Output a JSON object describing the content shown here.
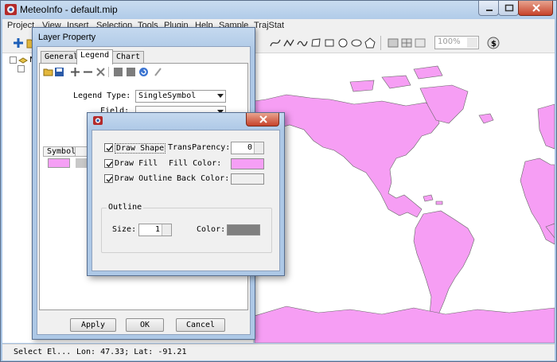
{
  "app": {
    "title": "MeteoInfo - default.mip"
  },
  "menu": [
    "Project",
    "View",
    "Insert",
    "Selection",
    "Tools",
    "Plugin",
    "Help",
    "Sample",
    "TrajStat"
  ],
  "toolbar": {
    "zoom_value": "100%"
  },
  "legend_tree": {
    "root_label": "Ne"
  },
  "status": {
    "left": "Select El...",
    "coords": "Lon: 47.33; Lat: -91.21"
  },
  "layer_dialog": {
    "title": "Layer Property",
    "tabs": [
      "General",
      "Legend",
      "Chart"
    ],
    "legend_type_label": "Legend Type:",
    "legend_type_value": "SingleSymbol",
    "field_label": "Field:",
    "symbol_col": "Symbol",
    "buttons": {
      "apply": "Apply",
      "ok": "OK",
      "cancel": "Cancel"
    }
  },
  "symbol_dialog": {
    "draw_shape": "Draw Shape",
    "draw_fill": "Draw Fill",
    "draw_outline": "Draw Outline",
    "transparency_label": "TransParency:",
    "transparency_value": "0",
    "fill_color_label": "Fill Color:",
    "back_color_label": "Back Color:",
    "outline_group": "Outline",
    "size_label": "Size:",
    "size_value": "1",
    "color_label": "Color:"
  },
  "colors": {
    "fill": "#f59ff5",
    "back": "#efefef",
    "outline": "#808080",
    "land": "#f69ef4"
  }
}
